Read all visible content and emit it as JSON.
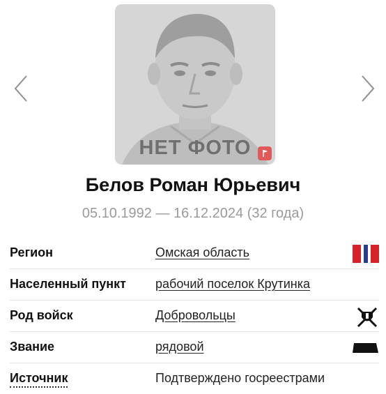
{
  "photo": {
    "placeholder_text": "НЕТ ФОТО"
  },
  "person": {
    "name": "Белов Роман Юрьевич",
    "dates": "05.10.1992 — 16.12.2024 (32 года)"
  },
  "rows": [
    {
      "label": "Регион",
      "value": "Омская область",
      "icon": "region-flag-icon"
    },
    {
      "label": "Населенный пункт",
      "value": "рабочий поселок Крутинка"
    },
    {
      "label": "Род войск",
      "value": "Добровольцы",
      "icon": "crossed-swords-emblem-icon"
    },
    {
      "label": "Звание",
      "value": "рядовой",
      "icon": "rank-insignia-icon"
    },
    {
      "label": "Источник",
      "value": "Подтверждено госреестрами"
    }
  ],
  "colors": {
    "accent_red": "#e15a5a",
    "muted_text": "#9a9a9a",
    "photo_bg": "#d9d9d9"
  }
}
